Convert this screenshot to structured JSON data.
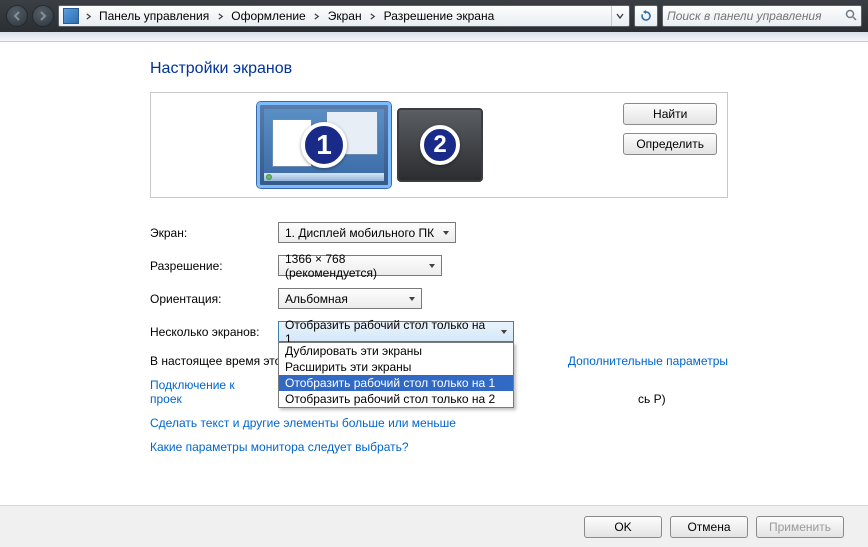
{
  "breadcrumb": {
    "items": [
      "Панель управления",
      "Оформление",
      "Экран",
      "Разрешение экрана"
    ]
  },
  "search": {
    "placeholder": "Поиск в панели управления"
  },
  "title": "Настройки экранов",
  "monitors": {
    "one": "1",
    "two": "2"
  },
  "buttons": {
    "find": "Найти",
    "identify": "Определить",
    "ok": "OK",
    "cancel": "Отмена",
    "apply": "Применить"
  },
  "labels": {
    "screen": "Экран:",
    "resolution": "Разрешение:",
    "orientation": "Ориентация:",
    "multiple": "Несколько экранов:"
  },
  "values": {
    "screen": "1. Дисплей мобильного ПК",
    "resolution": "1366 × 768 (рекомендуется)",
    "orientation": "Альбомная",
    "multiple": "Отобразить рабочий стол только на 1"
  },
  "multi_options": [
    "Дублировать эти экраны",
    "Расширить эти экраны",
    "Отобразить рабочий стол только на 1",
    "Отобразить рабочий стол только на 2"
  ],
  "multi_selected_index": 2,
  "status": {
    "prefix": "В настоящее время это",
    "advanced": "Дополнительные параметры"
  },
  "links": {
    "projector_prefix": "Подключение к проек",
    "projector_suffix": "сь Р)",
    "text_size": "Сделать текст и другие элементы больше или меньше",
    "which_monitor": "Какие параметры монитора следует выбрать?"
  }
}
